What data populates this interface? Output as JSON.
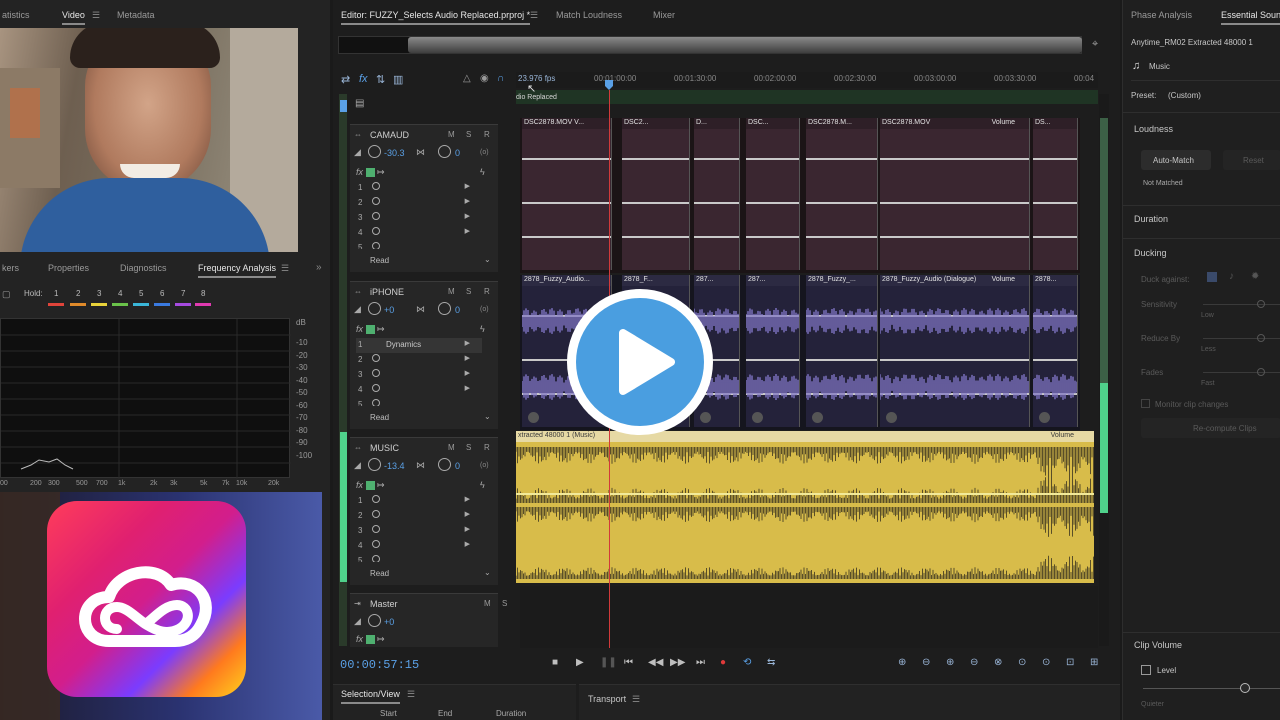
{
  "left_panel": {
    "top_tabs": [
      "atistics",
      "Video",
      "Metadata"
    ],
    "mid_tabs": [
      "kers",
      "Properties",
      "Diagnostics",
      "Frequency Analysis"
    ],
    "hold_label": "Hold:",
    "hold_numbers": [
      "1",
      "2",
      "3",
      "4",
      "5",
      "6",
      "7",
      "8"
    ],
    "hold_colors": [
      "#e0443a",
      "#e08a2a",
      "#e8d23a",
      "#6ac24a",
      "#3ab6d8",
      "#3a7ae0",
      "#a64ae0",
      "#e03ab0"
    ],
    "db_unit": "dB",
    "db_scale": [
      "-10",
      "-20",
      "-30",
      "-40",
      "-50",
      "-60",
      "-70",
      "-80",
      "-90",
      "-100"
    ],
    "hz_scale": [
      "00",
      "200",
      "300",
      "500",
      "700",
      "1k",
      "2k",
      "3k",
      "5k",
      "7k",
      "10k",
      "20k"
    ]
  },
  "editor": {
    "tabs": [
      "Editor: FUZZY_Selects Audio Replaced.prproj *",
      "Match Loudness",
      "Mixer"
    ],
    "fps": "23.976 fps",
    "sequence_label": "dio Replaced",
    "ruler": [
      "00:01:00:00",
      "00:01:30:00",
      "00:02:00:00",
      "00:02:30:00",
      "00:03:00:00",
      "00:03:30:00",
      "00:04"
    ],
    "timecode": "00:00:57:15",
    "tracks": [
      {
        "name": "CAMAUD",
        "volume": "-30.3",
        "pan": "0",
        "slots": [
          "1",
          "2",
          "3",
          "4",
          "5"
        ],
        "effect": "",
        "read": "Read",
        "clips": [
          "DSC2878.MOV V...",
          "DSC2...",
          "D...",
          "DSC...",
          "DSC2878.M...",
          "DSC2878.MOV",
          "DS..."
        ],
        "clip_volume_label": "Volume"
      },
      {
        "name": "iPHONE",
        "volume": "+0",
        "pan": "0",
        "slots": [
          "1",
          "2",
          "3",
          "4",
          "5"
        ],
        "effect": "Dynamics",
        "read": "Read",
        "clips": [
          "2878_Fuzzy_Audio...",
          "2878_F...",
          "287...",
          "287...",
          "2878_Fuzzy_...",
          "2878_Fuzzy_Audio (Dialogue)",
          "2878..."
        ],
        "clip_volume_label": "Volume"
      },
      {
        "name": "MUSIC",
        "volume": "-13.4",
        "pan": "0",
        "slots": [
          "1",
          "2",
          "3",
          "4",
          "5"
        ],
        "effect": "",
        "read": "Read",
        "clips": [
          "xtracted 48000 1 (Music)"
        ],
        "clip_volume_label": "Volume"
      },
      {
        "name": "Master",
        "volume": "+0",
        "pan": "",
        "slots": [],
        "effect": "",
        "read": "",
        "clips": [],
        "clip_volume_label": ""
      }
    ],
    "bottom_tabs": [
      "Selection/View",
      "Transport"
    ],
    "selection_cols": [
      "Start",
      "End",
      "Duration"
    ]
  },
  "right_panel": {
    "tabs": [
      "Phase Analysis",
      "Essential Soun"
    ],
    "clip_name": "Anytime_RM02 Extracted 48000 1",
    "type_label": "Music",
    "preset_label": "Preset:",
    "preset_value": "(Custom)",
    "loudness_header": "Loudness",
    "auto_match": "Auto-Match",
    "reset": "Reset",
    "not_matched": "Not Matched",
    "duration_header": "Duration",
    "ducking_header": "Ducking",
    "duck_against": "Duck against:",
    "sensitivity": "Sensitivity",
    "low": "Low",
    "reduce_by": "Reduce By",
    "less": "Less",
    "fades": "Fades",
    "fast": "Fast",
    "monitor": "Monitor clip changes",
    "keyframes": "Re-compute Clips",
    "clip_volume_header": "Clip Volume",
    "level_label": "Level",
    "quieter": "Quieter"
  },
  "colors": {
    "accent_blue": "#5aa0e6",
    "track_green": "#4fd18b",
    "music_yellow": "#d8bc4a",
    "dialogue_purple": "#7f74c4",
    "camaud_bg": "#3a2630",
    "playhead": "#d23a3a"
  },
  "icons": {
    "play_overlay": "play-button-icon",
    "logo": "creative-cloud-logo"
  }
}
